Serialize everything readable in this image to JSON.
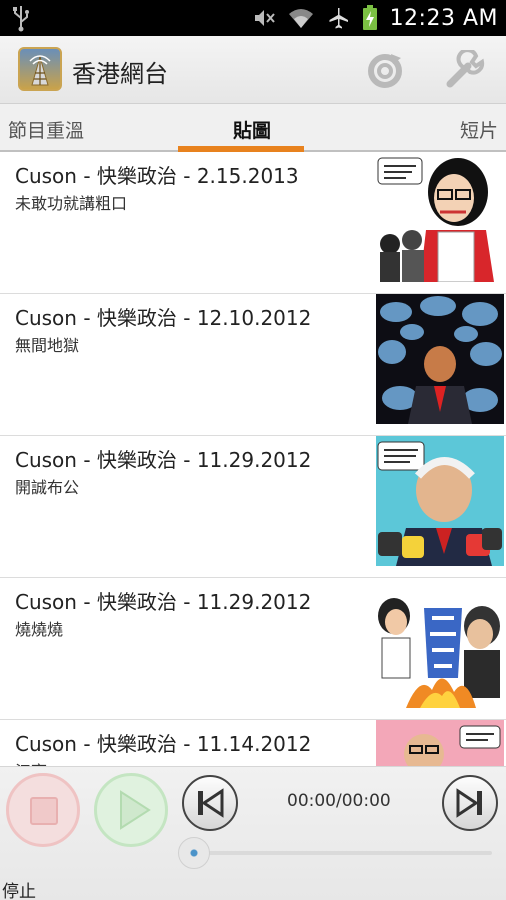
{
  "status_bar": {
    "time": "12:23 AM",
    "icons": [
      "usb-icon",
      "mute-icon",
      "wifi-icon",
      "airplane-icon",
      "battery-charging-icon"
    ]
  },
  "action_bar": {
    "title": "香港網台",
    "actions": [
      "refresh-icon",
      "wrench-icon"
    ]
  },
  "tabs": [
    {
      "label": "節目重溫",
      "selected": false
    },
    {
      "label": "貼圖",
      "selected": true
    },
    {
      "label": "短片",
      "selected": false
    }
  ],
  "colors": {
    "accent": "#e8821e",
    "status_bar": "#000000",
    "list_bg": "#ffffff"
  },
  "list": {
    "items": [
      {
        "title": "Cuson - 快樂政治 - 2.15.2013",
        "subtitle": "未敢功就講粗口"
      },
      {
        "title": "Cuson - 快樂政治 - 12.10.2012",
        "subtitle": "無間地獄"
      },
      {
        "title": "Cuson - 快樂政治 - 11.29.2012",
        "subtitle": "開誠布公"
      },
      {
        "title": "Cuson - 快樂政治 - 11.29.2012",
        "subtitle": "燒燒燒"
      },
      {
        "title": "Cuson - 快樂政治 - 11.14.2012",
        "subtitle": "江亨"
      }
    ]
  },
  "player": {
    "time": "00:00/00:00",
    "status": "停止",
    "progress": 0
  }
}
